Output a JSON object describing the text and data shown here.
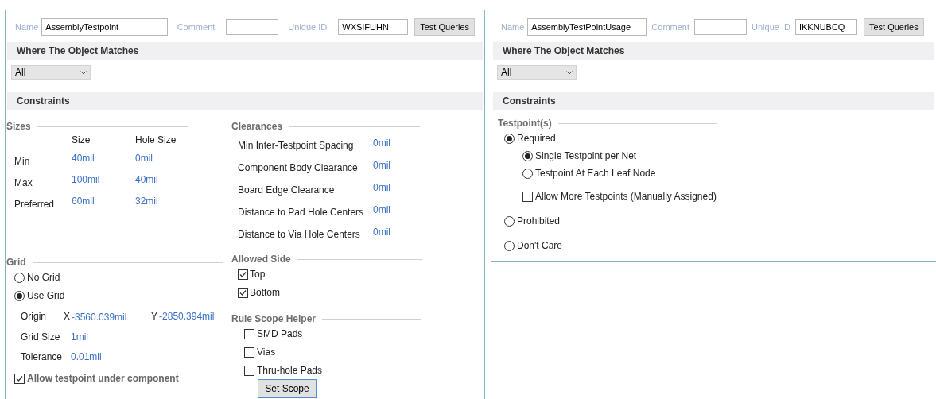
{
  "rules": [
    {
      "kind": "testpoint_style",
      "header": {
        "name_label": "Name",
        "name": "AssemblyTestpoint",
        "comment_label": "Comment",
        "unique_id_label": "Unique ID",
        "unique_id": "WXSIFUHN",
        "test_button": "Test Queries"
      },
      "where_title": "Where The Object Matches",
      "where_value": "All",
      "constraints_title": "Constraints",
      "sizes": {
        "title": "Sizes",
        "columns": [
          "Size",
          "Hole Size"
        ],
        "rows": [
          {
            "label": "Min",
            "size": "40mil",
            "hole_size": "0mil"
          },
          {
            "label": "Max",
            "size": "100mil",
            "hole_size": "40mil"
          },
          {
            "label": "Preferred",
            "size": "60mil",
            "hole_size": "32mil"
          }
        ]
      },
      "clearances": {
        "title": "Clearances",
        "rows": [
          {
            "label": "Min Inter-Testpoint Spacing",
            "value": "0mil"
          },
          {
            "label": "Component Body Clearance",
            "value": "0mil"
          },
          {
            "label": "Board Edge Clearance",
            "value": "0mil"
          },
          {
            "label": "Distance to Pad Hole Centers",
            "value": "0mil"
          },
          {
            "label": "Distance to Via Hole Centers",
            "value": "0mil"
          }
        ]
      },
      "grid": {
        "title": "Grid",
        "options": [
          {
            "label": "No Grid",
            "selected": false
          },
          {
            "label": "Use Grid",
            "selected": true
          }
        ],
        "origin_label": "Origin",
        "x_label": "X",
        "x": "-3560.039mil",
        "y_label": "Y",
        "y": "-2850.394mil",
        "grid_size_label": "Grid Size",
        "grid_size": "1mil",
        "tolerance_label": "Tolerance",
        "tolerance": "0.01mil"
      },
      "allow_under": {
        "label": "Allow testpoint under component",
        "checked": true
      },
      "allowed_side": {
        "title": "Allowed Side",
        "options": [
          {
            "label": "Top",
            "checked": true
          },
          {
            "label": "Bottom",
            "checked": true
          }
        ]
      },
      "scope_helper": {
        "title": "Rule Scope Helper",
        "options": [
          {
            "label": "SMD Pads",
            "checked": false
          },
          {
            "label": "Vias",
            "checked": false
          },
          {
            "label": "Thru-hole Pads",
            "checked": false
          }
        ],
        "button": "Set Scope"
      }
    },
    {
      "kind": "testpoint_usage",
      "header": {
        "name_label": "Name",
        "name": "AssemblyTestPointUsage",
        "comment_label": "Comment",
        "unique_id_label": "Unique ID",
        "unique_id": "IKKNUBCQ",
        "test_button": "Test Queries"
      },
      "where_title": "Where The Object Matches",
      "where_value": "All",
      "constraints_title": "Constraints",
      "testpoints": {
        "title": "Testpoint(s)",
        "options": [
          {
            "label": "Required",
            "selected": true,
            "children": [
              {
                "label": "Single Testpoint per Net",
                "selected": true
              },
              {
                "label": "Testpoint At Each Leaf Node",
                "selected": false
              }
            ],
            "extra": {
              "label": "Allow More Testpoints (Manually Assigned)",
              "checked": false
            }
          },
          {
            "label": "Prohibited",
            "selected": false
          },
          {
            "label": "Don't Care",
            "selected": false
          }
        ]
      }
    }
  ]
}
